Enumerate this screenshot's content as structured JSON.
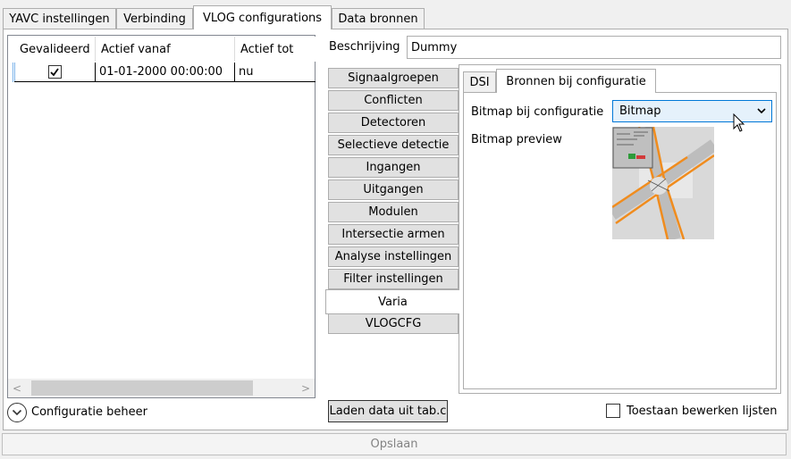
{
  "tabs": [
    "YAVC instellingen",
    "Verbinding",
    "VLOG configurations",
    "Data bronnen"
  ],
  "grid": {
    "headers": [
      "Gevalideerd",
      "Actief vanaf",
      "Actief tot"
    ],
    "rows": [
      {
        "checked": true,
        "actief_vanaf": "01-01-2000 00:00:00",
        "actief_tot": "nu"
      }
    ],
    "scroll_left": "<",
    "scroll_right": ">"
  },
  "configuratie_beheer": "Configuratie beheer",
  "beschrijving": {
    "label": "Beschrijving",
    "value": "Dummy"
  },
  "side_tabs": [
    "Signaalgroepen",
    "Conflicten",
    "Detectoren",
    "Selectieve detectie",
    "Ingangen",
    "Uitgangen",
    "Modulen",
    "Intersectie armen",
    "Analyse instellingen",
    "Filter instellingen",
    "Varia",
    "VLOGCFG"
  ],
  "inner_tabs": [
    "DSI",
    "Bronnen bij configuratie"
  ],
  "bitmap_label": "Bitmap bij configuratie",
  "bitmap_select_value": "Bitmap",
  "bitmap_preview_label": "Bitmap preview",
  "laden_button": "Laden data uit tab.c",
  "toestaan_label": "Toestaan bewerken lijsten",
  "opslaan_button": "Opslaan"
}
